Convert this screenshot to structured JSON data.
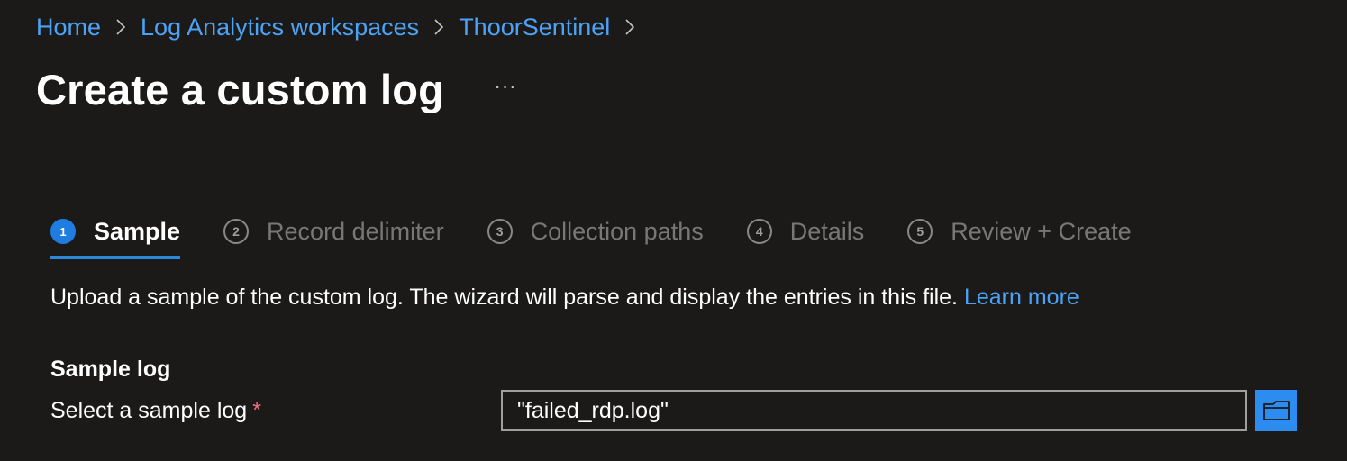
{
  "breadcrumb": [
    {
      "label": "Home"
    },
    {
      "label": "Log Analytics workspaces"
    },
    {
      "label": "ThoorSentinel"
    }
  ],
  "title": "Create a custom log",
  "more_label": "···",
  "steps": [
    {
      "number": "1",
      "label": "Sample",
      "active": true
    },
    {
      "number": "2",
      "label": "Record delimiter",
      "active": false
    },
    {
      "number": "3",
      "label": "Collection paths",
      "active": false
    },
    {
      "number": "4",
      "label": "Details",
      "active": false
    },
    {
      "number": "5",
      "label": "Review + Create",
      "active": false
    }
  ],
  "description": {
    "text": "Upload a sample of the custom log. The wizard will parse and display the entries in this file.",
    "link": "Learn more"
  },
  "sample_log": {
    "section_title": "Sample log",
    "field_label": "Select a sample log",
    "required_mark": "*",
    "value": "\"failed_rdp.log\""
  },
  "icons": {
    "breadcrumb_separator": "chevron-right-icon",
    "browse": "folder-icon"
  },
  "colors": {
    "background": "#1b1a19",
    "link": "#4ca3f5",
    "accent": "#1f7ce0",
    "browse_button": "#2d8cf0",
    "required": "#f1707b"
  }
}
